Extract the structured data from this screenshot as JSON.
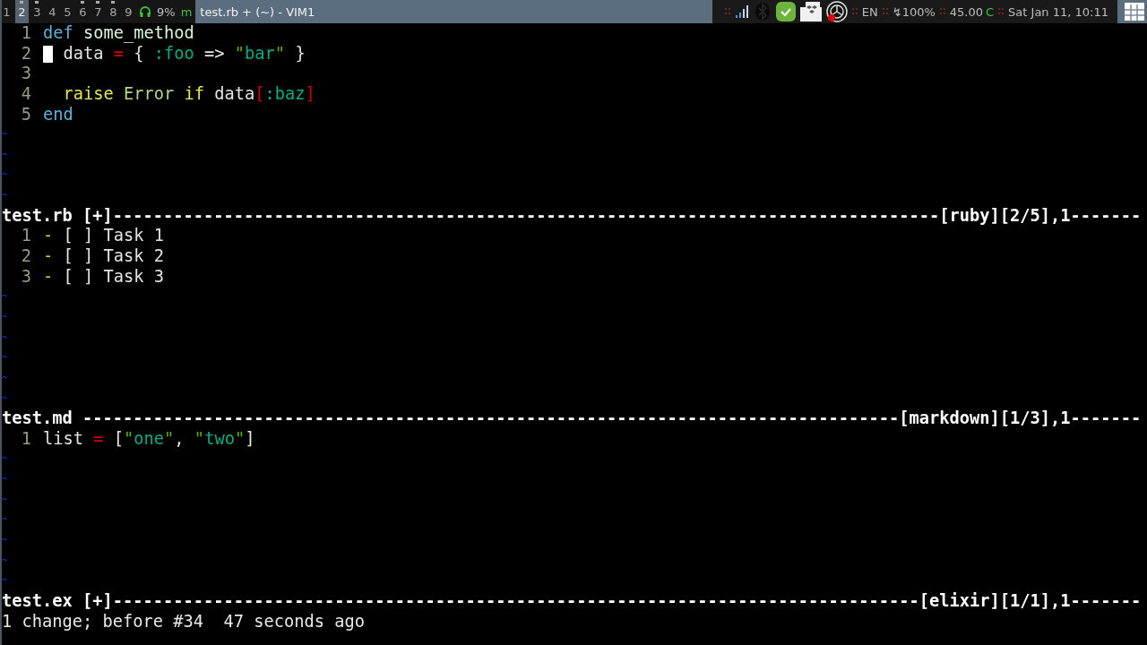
{
  "top_bar": {
    "workspaces": [
      {
        "label": "1",
        "selected": false,
        "occupied": false
      },
      {
        "label": "2",
        "selected": true,
        "occupied": true
      },
      {
        "label": "3",
        "selected": false,
        "occupied": true
      },
      {
        "label": "4",
        "selected": false,
        "occupied": false
      },
      {
        "label": "5",
        "selected": false,
        "occupied": false
      },
      {
        "label": "6",
        "selected": false,
        "occupied": true
      },
      {
        "label": "7",
        "selected": false,
        "occupied": true
      },
      {
        "label": "8",
        "selected": false,
        "occupied": true
      },
      {
        "label": "9",
        "selected": false,
        "occupied": false
      }
    ],
    "volume": "9%",
    "mode": "m",
    "window_title": "test.rb + (~) - VIM1",
    "language": "EN",
    "battery": "↯100%",
    "temperature": "45.00",
    "temperature_unit": "C",
    "clock": "Sat Jan 11, 10:11"
  },
  "panes": [
    {
      "lines": [
        {
          "number": "1",
          "cursor": false,
          "tokens": [
            {
              "text": "def",
              "kind": "keyword"
            },
            {
              "text": " some_method",
              "kind": "definition"
            }
          ]
        },
        {
          "number": "2",
          "cursor": true,
          "tokens": [
            {
              "text": "  data ",
              "kind": "plain"
            },
            {
              "text": "=",
              "kind": "operator"
            },
            {
              "text": " { ",
              "kind": "plain"
            },
            {
              "text": ":foo",
              "kind": "symbol"
            },
            {
              "text": " => ",
              "kind": "plain"
            },
            {
              "text": "\"",
              "kind": "quote"
            },
            {
              "text": "bar",
              "kind": "string"
            },
            {
              "text": "\"",
              "kind": "quote"
            },
            {
              "text": " }",
              "kind": "plain"
            }
          ]
        },
        {
          "number": "3",
          "cursor": false
        },
        {
          "number": "4",
          "cursor": false,
          "tokens": [
            {
              "text": "  raise",
              "kind": "conditional"
            },
            {
              "text": " Error",
              "kind": "constant"
            },
            {
              "text": " if",
              "kind": "conditional"
            },
            {
              "text": " data",
              "kind": "plain"
            },
            {
              "text": "[",
              "kind": "error"
            },
            {
              "text": ":baz",
              "kind": "symbol"
            },
            {
              "text": "]",
              "kind": "error"
            }
          ]
        },
        {
          "number": "5",
          "cursor": false,
          "tokens": [
            {
              "text": "end",
              "kind": "keyword"
            }
          ]
        }
      ],
      "filler": [
        "~",
        "~",
        "~",
        "~"
      ],
      "status": "test.rb [+]----------------------------------------------------------------------------------[ruby][2/5],1-------"
    },
    {
      "lines": [
        {
          "number": "1",
          "cursor": false,
          "tokens": [
            {
              "text": "-",
              "kind": "list_marker"
            },
            {
              "text": " [ ] Task 1",
              "kind": "plain"
            }
          ]
        },
        {
          "number": "2",
          "cursor": false,
          "tokens": [
            {
              "text": "-",
              "kind": "list_marker"
            },
            {
              "text": " [ ] Task 2",
              "kind": "plain"
            }
          ]
        },
        {
          "number": "3",
          "cursor": false,
          "tokens": [
            {
              "text": "-",
              "kind": "list_marker"
            },
            {
              "text": " [ ] Task 3",
              "kind": "plain"
            }
          ]
        }
      ],
      "filler": [
        "~",
        "~",
        "~",
        "~",
        "~",
        "~"
      ],
      "status": "test.md ---------------------------------------------------------------------------------[markdown][1/3],1-------"
    },
    {
      "lines": [
        {
          "number": "1",
          "cursor": false,
          "tokens": [
            {
              "text": "list ",
              "kind": "plain"
            },
            {
              "text": "=",
              "kind": "operator"
            },
            {
              "text": " [",
              "kind": "plain"
            },
            {
              "text": "\"",
              "kind": "quote"
            },
            {
              "text": "one",
              "kind": "string"
            },
            {
              "text": "\"",
              "kind": "quote"
            },
            {
              "text": ", ",
              "kind": "plain"
            },
            {
              "text": "\"",
              "kind": "quote"
            },
            {
              "text": "two",
              "kind": "string"
            },
            {
              "text": "\"",
              "kind": "quote"
            },
            {
              "text": "]",
              "kind": "plain"
            }
          ]
        }
      ],
      "filler": [
        "~",
        "~",
        "~",
        "~",
        "~",
        "~",
        "~"
      ],
      "status": "test.ex [+]--------------------------------------------------------------------------------[elixir][1/1],1-------"
    }
  ],
  "command_line": "1 change; before #34  47 seconds ago"
}
